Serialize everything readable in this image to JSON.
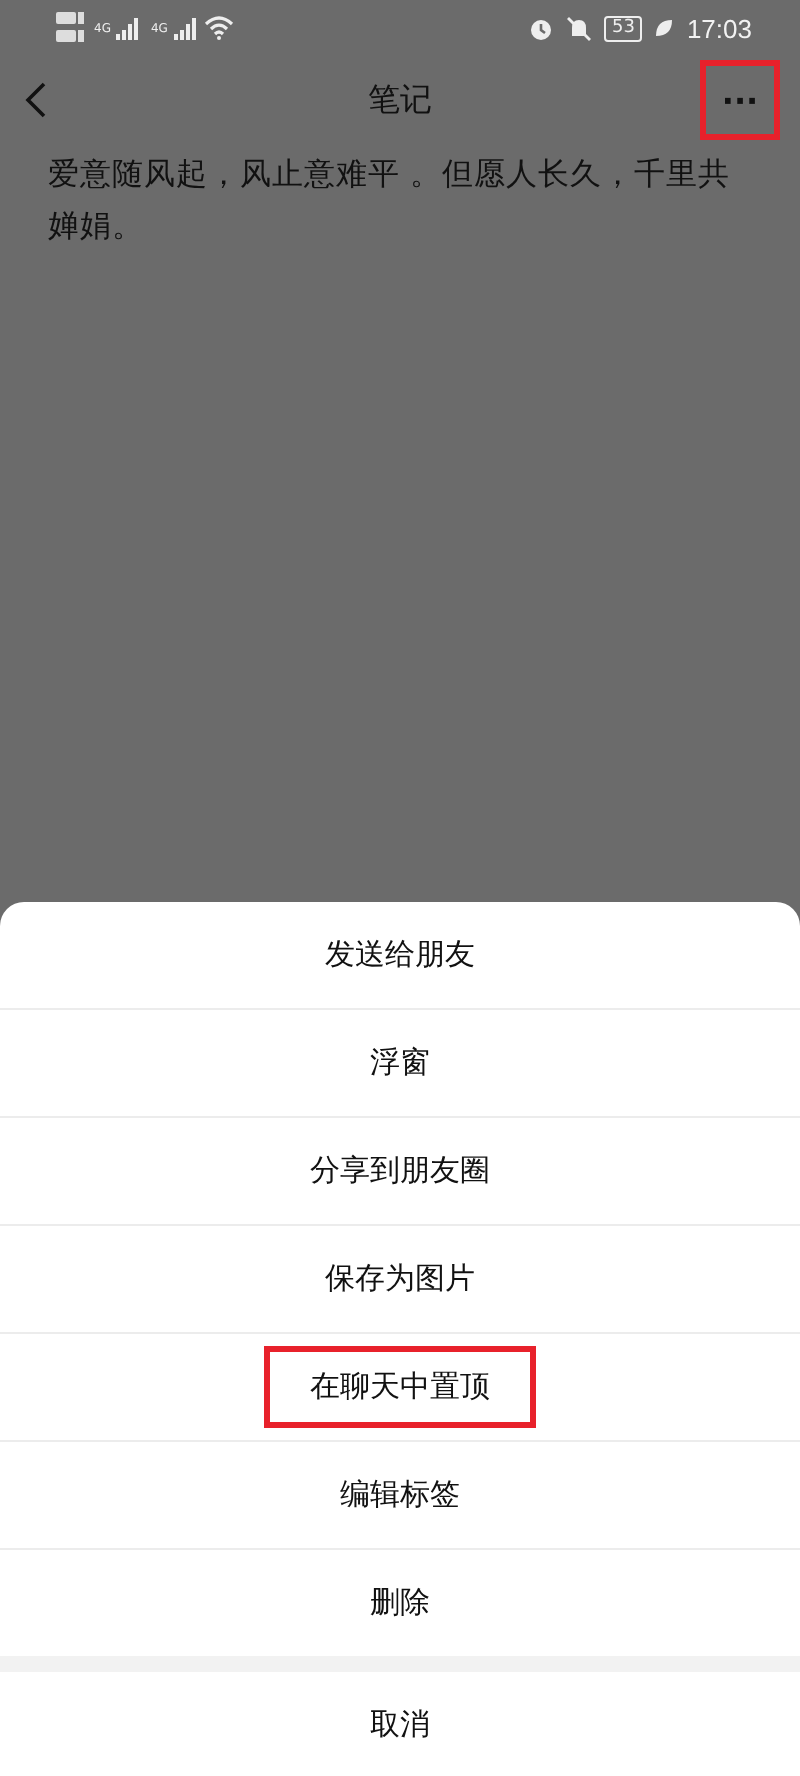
{
  "status_bar": {
    "network_labels": [
      "4G",
      "4G"
    ],
    "battery": "53",
    "time": "17:03"
  },
  "nav": {
    "title": "笔记",
    "more": {
      "label": "···",
      "highlighted": true
    }
  },
  "note": {
    "text": "爱意随风起，风止意难平 。但愿人长久，千里共婵娟。"
  },
  "menu": {
    "items": [
      {
        "label": "发送给朋友",
        "highlighted": false
      },
      {
        "label": "浮窗",
        "highlighted": false
      },
      {
        "label": "分享到朋友圈",
        "highlighted": false
      },
      {
        "label": "保存为图片",
        "highlighted": false
      },
      {
        "label": "在聊天中置顶",
        "highlighted": true
      },
      {
        "label": "编辑标签",
        "highlighted": false
      },
      {
        "label": "删除",
        "highlighted": false
      }
    ],
    "cancel": "取消"
  }
}
